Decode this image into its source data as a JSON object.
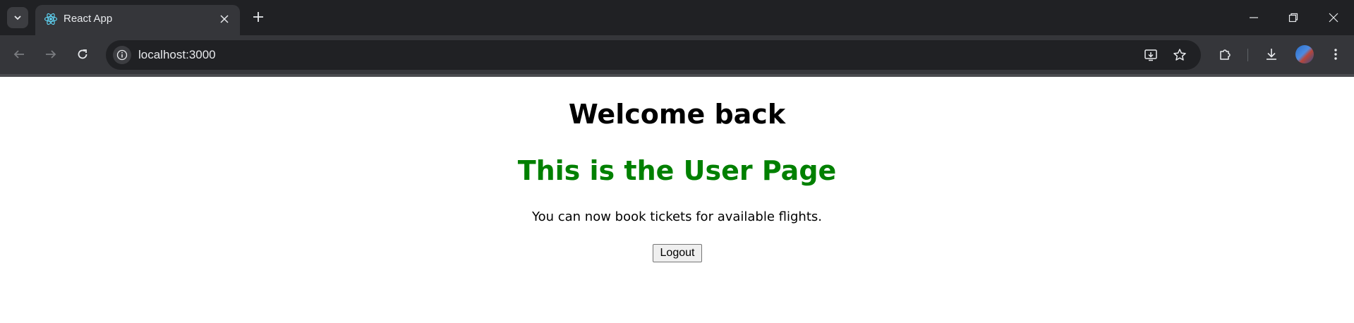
{
  "browser": {
    "tab": {
      "title": "React App",
      "favicon": "react-logo-icon"
    },
    "address_bar": {
      "url": "localhost:3000"
    },
    "icons": {
      "tab_search": "chevron-down-icon",
      "tab_close": "close-icon",
      "new_tab": "plus-icon",
      "minimize": "minimize-icon",
      "restore": "restore-icon",
      "close_window": "close-icon",
      "back": "arrow-left-icon",
      "forward": "arrow-right-icon",
      "reload": "reload-icon",
      "site_info": "info-icon",
      "install": "install-app-icon",
      "bookmark": "star-icon",
      "extensions": "puzzle-icon",
      "downloads": "download-icon",
      "profile": "avatar",
      "menu": "kebab-menu-icon"
    },
    "colors": {
      "tabstrip": "#202124",
      "toolbar": "#35363a",
      "text": "#e8eaed"
    }
  },
  "page": {
    "welcome_heading": "Welcome back",
    "user_heading": "This is the User Page",
    "message": "You can now book tickets for available flights.",
    "logout_label": "Logout",
    "colors": {
      "user_heading": "#008000"
    }
  }
}
